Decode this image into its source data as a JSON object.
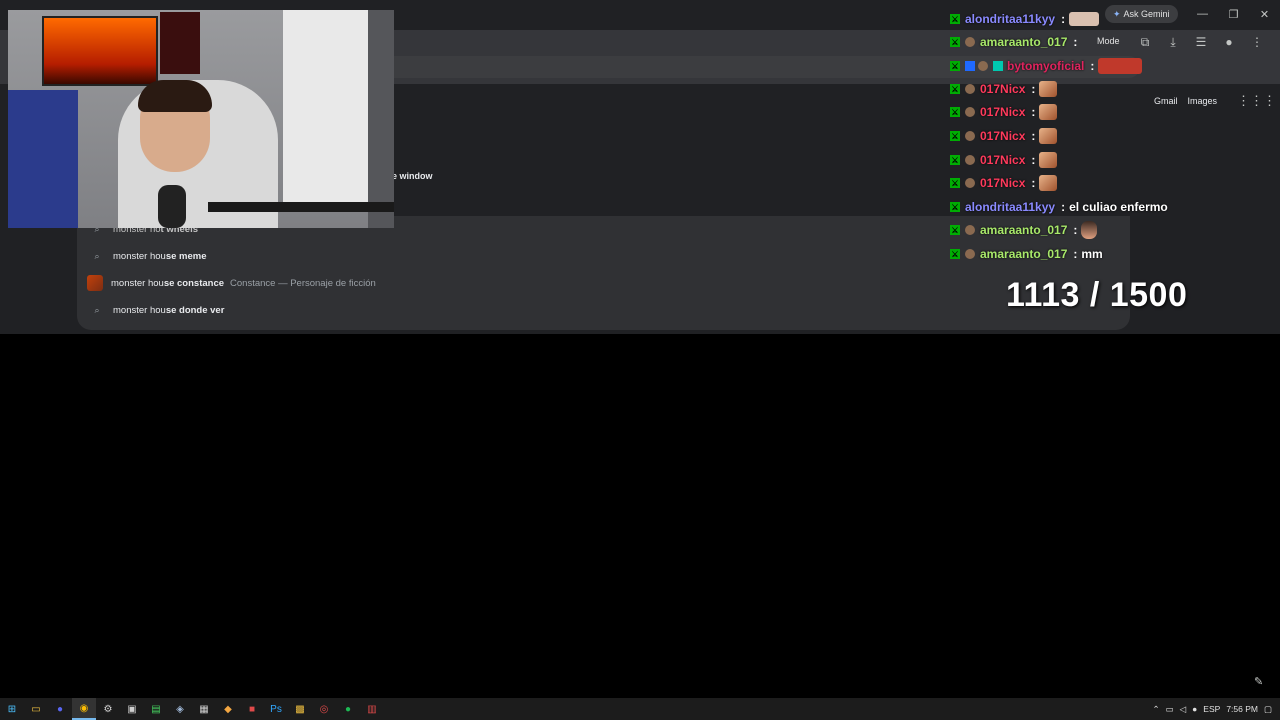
{
  "browser": {
    "ask_gemini": "Ask Gemini",
    "mode_label": "Mode",
    "window_hint": "e window",
    "links": {
      "gmail": "Gmail",
      "images": "Images"
    }
  },
  "suggestions": [
    {
      "prefix": "monster ho",
      "suffix": "t wheels",
      "sub": "",
      "icon": "search-icon"
    },
    {
      "prefix": "monster hou",
      "suffix": "se meme",
      "sub": "",
      "icon": "search-icon"
    },
    {
      "prefix": "monster hou",
      "suffix": "se constance",
      "sub": "Constance — Personaje de ficción",
      "icon": "thumbnail"
    },
    {
      "prefix": "monster hou",
      "suffix": "se donde ver",
      "sub": "",
      "icon": "search-icon"
    }
  ],
  "chat": [
    {
      "user": "alondritaa11kyy",
      "color": "#8a8aff",
      "message": "",
      "emote": "wide"
    },
    {
      "user": "amaraanto_017",
      "color": "#a8e86a",
      "message": "",
      "emote": ""
    },
    {
      "user": "bytomyoficial",
      "color": "#e0245e",
      "message": "",
      "emote": "red"
    },
    {
      "user": "017Nicx",
      "color": "#ff3a5c",
      "message": "",
      "emote": "square"
    },
    {
      "user": "017Nicx",
      "color": "#ff3a5c",
      "message": "",
      "emote": "square"
    },
    {
      "user": "017Nicx",
      "color": "#ff3a5c",
      "message": "",
      "emote": "square"
    },
    {
      "user": "017Nicx",
      "color": "#ff3a5c",
      "message": "",
      "emote": "square"
    },
    {
      "user": "017Nicx",
      "color": "#ff3a5c",
      "message": "",
      "emote": "square"
    },
    {
      "user": "alondritaa11kyy",
      "color": "#8a8aff",
      "message": "el culiao enfermo",
      "emote": ""
    },
    {
      "user": "amaraanto_017",
      "color": "#a8e86a",
      "message": "",
      "emote": "face"
    },
    {
      "user": "amaraanto_017",
      "color": "#a8e86a",
      "message": "mm",
      "emote": ""
    }
  ],
  "counter": "1113 / 1500",
  "taskbar": {
    "language": "ESP",
    "time": "7:56 PM"
  }
}
